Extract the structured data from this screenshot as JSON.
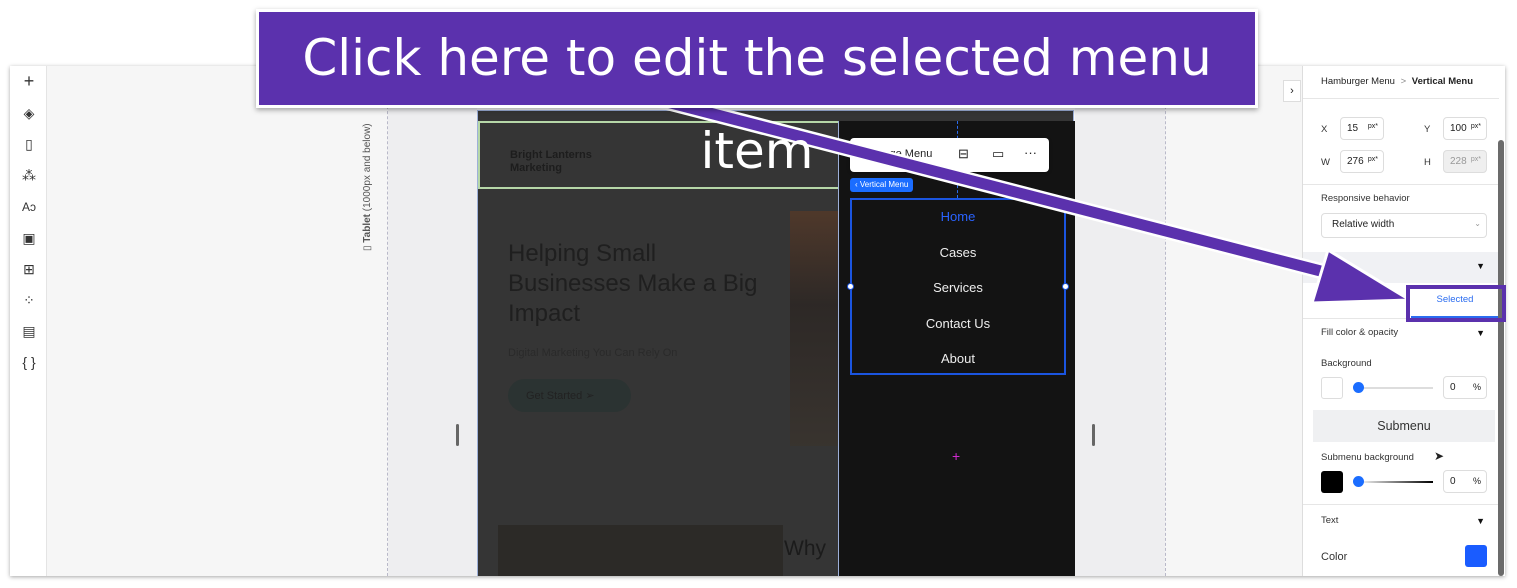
{
  "toolbar": {
    "items": [
      "add",
      "layers",
      "pages",
      "components",
      "theme",
      "media",
      "apps",
      "add-ons",
      "cms",
      "code"
    ]
  },
  "canvas": {
    "breakpoint_label": "Tablet",
    "breakpoint_range": "(1000px and below)"
  },
  "site": {
    "brand": "Bright Lanterns Marketing",
    "hero": "Helping Small Businesses Make a Big Impact",
    "subtitle": "Digital Marketing You Can Rely On",
    "cta": "Get Started",
    "section_heading": "Why",
    "menu_items": [
      "Home",
      "Cases",
      "Services",
      "Contact Us",
      "About"
    ],
    "active_item_color": "#1b55e0"
  },
  "context_toolbar": {
    "manage_label": "Manage Menu",
    "element_tag": "Vertical Menu"
  },
  "panel": {
    "breadcrumb_parent": "Hamburger Menu",
    "breadcrumb_sep": ">",
    "breadcrumb_current": "Vertical Menu",
    "x_label": "X",
    "x_value": "15",
    "y_label": "Y",
    "y_value": "100",
    "w_label": "W",
    "w_value": "276",
    "h_label": "H",
    "h_value": "228",
    "unit": "px*",
    "responsive_label": "Responsive behavior",
    "responsive_value": "Relative width",
    "tab_selected": "Selected",
    "fill_label": "Fill color & opacity",
    "background_label": "Background",
    "background_opacity": "0",
    "percent": "%",
    "submenu_button": "Submenu",
    "submenu_bg_label": "Submenu background",
    "submenu_bg_opacity": "0",
    "text_label": "Text",
    "color_label": "Color",
    "color_value": "#1a5cff"
  },
  "callout": {
    "text": "Click here to edit the selected menu item",
    "color": "#5b31ad"
  }
}
